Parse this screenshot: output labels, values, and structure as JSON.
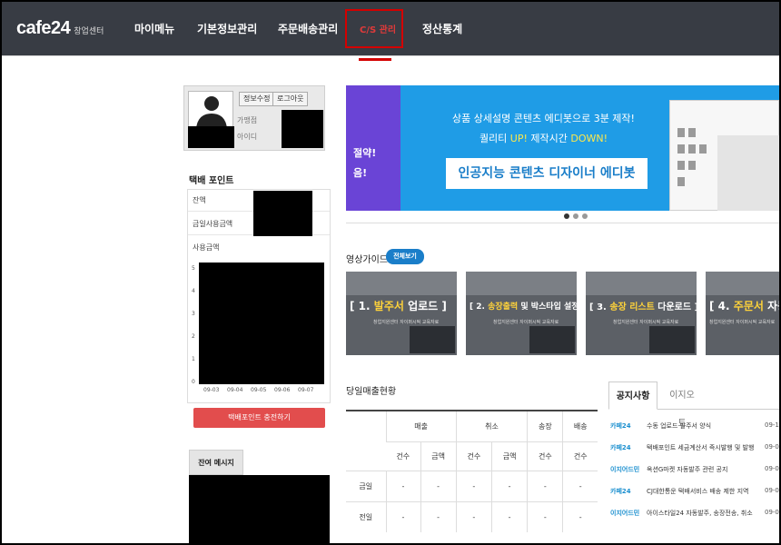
{
  "nav": {
    "logo": "cafe24",
    "logo_sub": "창업센터",
    "items": [
      "마이메뉴",
      "기본정보관리",
      "주문배송관리",
      "C/S 관리",
      "정산통계"
    ]
  },
  "profile": {
    "info_btn": "정보수정",
    "logout_btn": "로그아웃",
    "store_label": "가맹점",
    "id_label": "아이디"
  },
  "points": {
    "title": "택배 포인트",
    "balance_label": "잔액",
    "today_label": "금일사용금액",
    "usage_label": "사용금액",
    "y_ticks": [
      "5",
      "4",
      "3",
      "2",
      "1",
      "0"
    ],
    "x_ticks": [
      "09-03",
      "09-04",
      "09-05",
      "09-06",
      "09-07"
    ],
    "recharge_btn": "택배포인트 충전하기"
  },
  "sms": {
    "title": "잔여 메시지"
  },
  "banner": {
    "side_a": "절약!",
    "side_b": "음!",
    "line1": "상품 상세설명 콘텐츠 에디봇으로 3분 제작!",
    "line2_a": "퀄리티 ",
    "line2_b": "UP!",
    "line2_c": " 제작시간 ",
    "line2_d": "DOWN!",
    "cta": "인공지능 콘텐츠 디자이너 에디봇"
  },
  "video": {
    "title": "영상가이드",
    "view_all": "전체보기",
    "cards": [
      {
        "num": "1.",
        "a": "발주서",
        "b": " 업로드"
      },
      {
        "num": "2.",
        "a": "송장출력",
        "b": " 및 박스타입 설정"
      },
      {
        "num": "3.",
        "a": "송장 리스트",
        "b": " 다운로드"
      },
      {
        "num": "4.",
        "a": "주문서",
        "b": " 자동"
      }
    ],
    "caption": "창업지원센터 자이퍼시픽 교육자료"
  },
  "sales": {
    "title": "당일매출현황",
    "groups": [
      "매출",
      "취소",
      "송장",
      "배송"
    ],
    "subcols": [
      "건수",
      "금액",
      "건수",
      "금액",
      "건수",
      "건수"
    ],
    "rows": [
      {
        "label": "금일",
        "cells": [
          "-",
          "-",
          "-",
          "-",
          "-",
          "-"
        ]
      },
      {
        "label": "전일",
        "cells": [
          "-",
          "-",
          "-",
          "-",
          "-",
          "-"
        ]
      }
    ]
  },
  "notice": {
    "tab_active": "공지사항",
    "tab_other": "이지오토",
    "items": [
      {
        "tag": "카페24",
        "text": "수동 업로드 발주서 양식",
        "date": "09-1"
      },
      {
        "tag": "카페24",
        "text": "택배포인트 세금계산서 즉시발행 및 발행",
        "date": "09-0"
      },
      {
        "tag": "이지어드민",
        "text": "옥션G마켓 자동발주 관련 공지",
        "date": "09-0"
      },
      {
        "tag": "카페24",
        "text": "CJ대한통운 택배서비스 배송 제한 지역",
        "date": "09-0"
      },
      {
        "tag": "이지어드민",
        "text": "아이스타일24 자동발주, 송장전송, 취소",
        "date": "09-0"
      }
    ]
  }
}
